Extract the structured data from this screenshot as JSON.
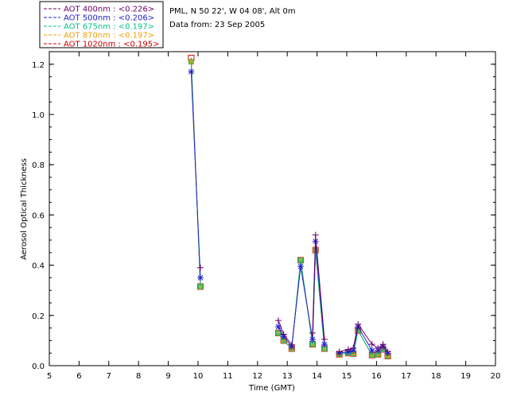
{
  "info": {
    "location": "PML, N 50 22', W 04 08', Alt 0m",
    "date": "Data from: 23 Sep 2005"
  },
  "chart_data": {
    "type": "scatter",
    "xlabel": "Time (GMT)",
    "ylabel": "Aerosol Optical Thickness",
    "xlim": [
      5,
      20
    ],
    "ylim": [
      0,
      1.25
    ],
    "xticks": [
      5,
      6,
      7,
      8,
      9,
      10,
      11,
      12,
      13,
      14,
      15,
      16,
      17,
      18,
      19,
      20
    ],
    "yticks": [
      0.0,
      0.2,
      0.4,
      0.6,
      0.8,
      1.0,
      1.2
    ],
    "ytick_labels": [
      "0.0",
      "0.2",
      "0.4",
      "0.6",
      "0.8",
      "1.0",
      "1.2"
    ],
    "grid": false,
    "legend_position": "top-left, outside plot",
    "series": [
      {
        "name": "AOT  400nm : <0.226>",
        "color": "#6b006b",
        "marker": "plus",
        "x": [
          10.08,
          12.7,
          12.88,
          13.15,
          13.85,
          13.95,
          14.25,
          14.75,
          15.05,
          15.22,
          15.38,
          15.85,
          16.05,
          16.22,
          16.38
        ],
        "y": [
          0.39,
          0.18,
          0.125,
          0.083,
          0.13,
          0.52,
          0.105,
          0.055,
          0.065,
          0.07,
          0.165,
          0.085,
          0.07,
          0.085,
          0.055
        ]
      },
      {
        "name": "AOT  500nm : <0.206>",
        "color": "#2222cc",
        "marker": "asterisk",
        "x": [
          9.77,
          10.08,
          12.7,
          12.88,
          13.15,
          13.45,
          13.85,
          13.95,
          14.25,
          14.75,
          15.05,
          15.22,
          15.38,
          15.85,
          16.05,
          16.22,
          16.38
        ],
        "y": [
          1.17,
          0.35,
          0.155,
          0.115,
          0.075,
          0.395,
          0.105,
          0.495,
          0.085,
          0.05,
          0.055,
          0.06,
          0.155,
          0.06,
          0.06,
          0.075,
          0.05
        ]
      },
      {
        "name": "AOT  675nm : <0.197>",
        "color": "#00c48a",
        "marker": "square",
        "x": [
          9.77,
          10.08,
          12.7,
          12.88,
          13.15,
          13.45,
          13.85,
          13.95,
          14.25,
          14.75,
          15.05,
          15.22,
          15.38,
          15.85,
          16.05,
          16.22,
          16.38
        ],
        "y": [
          1.21,
          0.315,
          0.13,
          0.1,
          0.068,
          0.42,
          0.085,
          0.46,
          0.068,
          0.045,
          0.05,
          0.048,
          0.14,
          0.042,
          0.045,
          0.065,
          0.038
        ]
      },
      {
        "name": "AOT  870nm : <0.197>",
        "color": "#f0a000",
        "marker": "square",
        "x": [
          9.77,
          10.08,
          12.7,
          12.88,
          13.15,
          13.45,
          13.85,
          13.95,
          14.25,
          14.75,
          15.05,
          15.22,
          15.38,
          15.85,
          16.05,
          16.22,
          16.38
        ],
        "y": [
          1.21,
          0.315,
          0.13,
          0.1,
          0.068,
          0.42,
          0.085,
          0.46,
          0.068,
          0.045,
          0.05,
          0.048,
          0.14,
          0.042,
          0.045,
          0.065,
          0.038
        ]
      },
      {
        "name": "AOT 1020nm : <0.195>",
        "color": "#cc0000",
        "marker": "square",
        "x": [
          9.77,
          10.08,
          12.7,
          12.88,
          13.15,
          13.45,
          13.85,
          13.95,
          14.25,
          14.75,
          15.05,
          15.22,
          15.38,
          15.85,
          16.05,
          16.22,
          16.38
        ],
        "y": [
          1.225,
          0.315,
          0.13,
          0.1,
          0.068,
          0.42,
          0.085,
          0.46,
          0.068,
          0.045,
          0.05,
          0.048,
          0.14,
          0.042,
          0.045,
          0.065,
          0.038
        ]
      }
    ]
  }
}
